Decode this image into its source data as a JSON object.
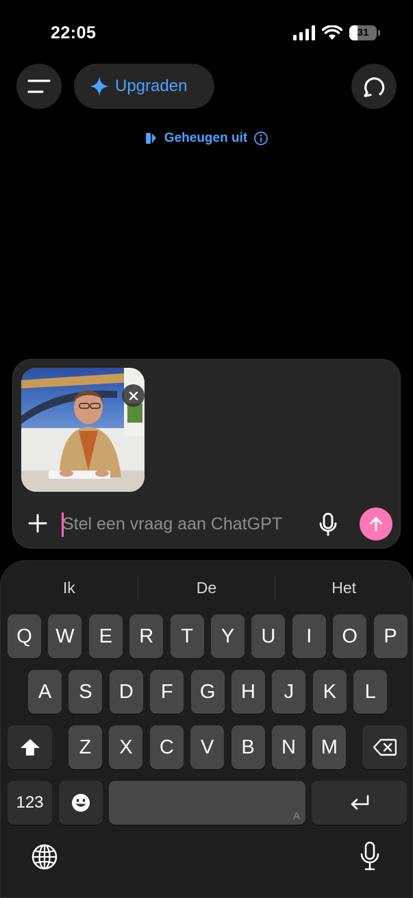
{
  "status_bar": {
    "time": "22:05",
    "battery_level": "31"
  },
  "header": {
    "upgrade_label": "Upgraden",
    "memory_label": "Geheugen uit"
  },
  "composer": {
    "placeholder": "Stel een vraag aan ChatGPT",
    "attachment_icon": "photo-thumbnail"
  },
  "keyboard": {
    "suggestions": [
      "Ik",
      "De",
      "Het"
    ],
    "row1": [
      "Q",
      "W",
      "E",
      "R",
      "T",
      "Y",
      "U",
      "I",
      "O",
      "P"
    ],
    "row2": [
      "A",
      "S",
      "D",
      "F",
      "G",
      "H",
      "J",
      "K",
      "L"
    ],
    "row3": [
      "Z",
      "X",
      "C",
      "V",
      "B",
      "N",
      "M"
    ],
    "numbers_label": "123",
    "space_mark": "A"
  },
  "colors": {
    "accent_blue": "#4aa3ff",
    "send_pink": "#ff77b9"
  }
}
